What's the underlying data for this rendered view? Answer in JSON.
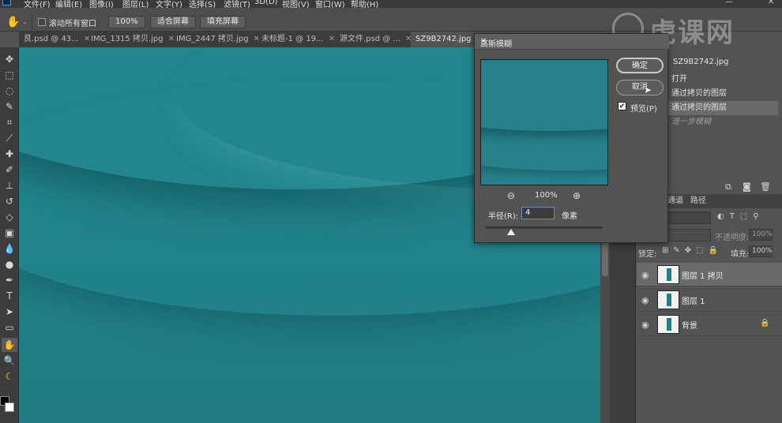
{
  "menu": [
    "文件(F)",
    "编辑(E)",
    "图像(I)",
    "图层(L)",
    "文字(Y)",
    "选择(S)",
    "滤镜(T)",
    "3D(D)",
    "视图(V)",
    "窗口(W)",
    "帮助(H)"
  ],
  "options": {
    "scroll_all_label": "滚动所有窗口",
    "zoom_label": "100%",
    "fit_label": "适合屏幕",
    "fill_label": "填充屏幕"
  },
  "tabs": [
    {
      "label": "艮.psd @ 43...",
      "active": false
    },
    {
      "label": "IMG_1315 拷贝.jpg",
      "active": false
    },
    {
      "label": "IMG_2447 拷贝.jpg",
      "active": false
    },
    {
      "label": "未标题-1 @ 19...",
      "active": false
    },
    {
      "label": "源文件.psd @ ...",
      "active": false
    },
    {
      "label": "SZ9B2742.jpg @",
      "active": true
    }
  ],
  "dialog": {
    "title": "高斯模糊",
    "ok_label": "确定",
    "cancel_label": "取消",
    "preview_label": "预览(P)",
    "preview_checked": true,
    "zoom_value": "100%",
    "radius_label": "半径(R):",
    "radius_value": "4",
    "unit_label": "像素",
    "slider_value": 0.05
  },
  "history": {
    "doc_name": "SZ9B2742.jpg",
    "items": [
      {
        "label": "打开",
        "selected": false
      },
      {
        "label": "通过拷贝的图层",
        "selected": false
      },
      {
        "label": "通过拷贝的图层",
        "selected": true
      },
      {
        "label": "退一步模糊",
        "selected": false
      }
    ]
  },
  "layers_panel": {
    "tabs": [
      "通道",
      "路径"
    ],
    "opacity_label": "不透明度:",
    "opacity_value": "100%",
    "lock_label": "锁定:",
    "fill_label": "填充:",
    "fill_value": "100%",
    "layers": [
      {
        "name": "图层 1 拷贝",
        "selected": true,
        "locked": false
      },
      {
        "name": "图层 1",
        "selected": false,
        "locked": false
      },
      {
        "name": "背景",
        "selected": false,
        "locked": true
      }
    ]
  },
  "watermark": "虎课网",
  "colors": {
    "canvas": "#23868f",
    "panel": "#535353",
    "dark": "#3c3c3c"
  }
}
